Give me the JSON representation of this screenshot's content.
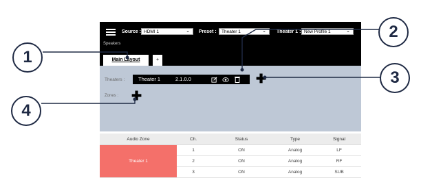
{
  "header": {
    "source_label": "Source :",
    "source_value": "HDMI 1",
    "preset_label": "Preset :",
    "preset_value": "Theater 1",
    "theater_label": "Theater 1 :",
    "theater_value": "New Profile 1",
    "speakers_label": "Speakers"
  },
  "tabs": [
    {
      "label": "Main Layout"
    },
    {
      "label": "+"
    }
  ],
  "panel": {
    "theaters_label": "Theaters :",
    "zones_label": "Zones :",
    "theater_name": "Theater 1",
    "theater_version": "2.1.0.0",
    "add_theater_glyph": "✚",
    "add_zone_glyph": "✚"
  },
  "table": {
    "headers": [
      "Audio Zone",
      "Ch.",
      "Status",
      "Type",
      "Signal"
    ],
    "zone_name": "Theater 1",
    "rows": [
      {
        "ch": "1",
        "status": "ON",
        "type": "Analog",
        "signal": "LF"
      },
      {
        "ch": "2",
        "status": "ON",
        "type": "Analog",
        "signal": "RF"
      },
      {
        "ch": "3",
        "status": "ON",
        "type": "Analog",
        "signal": "SUB"
      }
    ]
  },
  "callouts": [
    "1",
    "2",
    "3",
    "4"
  ],
  "colors": {
    "callout": "#1f2a44",
    "zone": "#f4706a",
    "panel": "#bec8d6"
  },
  "icons": [
    "menu-icon",
    "edit-icon",
    "view-icon",
    "delete-icon",
    "plus-icon"
  ]
}
